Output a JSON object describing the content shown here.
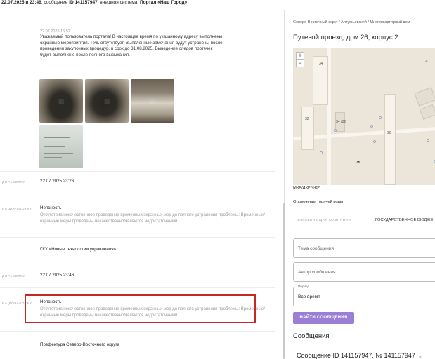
{
  "header": {
    "date": "22.07.2025 в 23:46",
    "rest": ", сообщение ",
    "msg_id": "ID 141157947",
    "system_prefix": ", внешняя система: ",
    "system": "Портал «Наш Город»"
  },
  "message": {
    "date": "22.07.2025 15:52",
    "text": "Уважаемый пользователь портала! В настоящее время по указанному адресу выполнены охранные мероприятия. Течь отсутствует. Выявленные замечания будут устранены после проведения закупочных процедур, в срок до 31.08.2025. Выведение следов протечек будет выполнено после полного высыхания."
  },
  "rows": {
    "r1_label": "ДОРАБОТКУ",
    "r1_value": "22.07.2025 23:26",
    "r2_label": "НА ДОРАБОТКУ",
    "r2_title": "Неясность",
    "r2_text": "Отсутствие/некачественное проведение временных/охранных мер до полного устранения проблемы: Временные/охранные меры проведены некачественно/являются недостаточными",
    "r3_value": "ГКУ «Новые технологии управления»",
    "r4_label": "ДОРАБОТКУ",
    "r4_value": "22.07.2025 23:46",
    "r5_label": "НА ДОРАБОТКУ",
    "r5_title": "Неясность",
    "r5_text": "Отсутствие/некачественное проведение временных/охранных мер до полного устранения проблемы: Временные/охранные меры проведены некачественно/являются недостаточными",
    "r6_value": "Префектура Северо-Восточного округа"
  },
  "right": {
    "breadcrumb": "Северо-Восточный округ / Алтуфьевский / Многоквартирный дом",
    "address": "Путевой проезд, дом 26, корпус 2",
    "map": {
      "zoom_in": "+",
      "zoom_out": "−",
      "b34": "34",
      "b32": "32",
      "b34k2": "34 (32",
      "b30": "30"
    },
    "mkr": "МКР/ДКР/ФКР",
    "outage": "Отключения горячей воды",
    "uk_label": "УПРАВЛЯЮЩАЯ КОМПАНИЯ",
    "uk_value": "ГОСУДАРСТВЕННОЕ БЮДЖЕ",
    "topic_placeholder": "Тема сообщения",
    "author_placeholder": "Автор сообщения",
    "period_legend": "Период",
    "period_value": "Все время",
    "search_button": "НАЙТИ СООБЩЕНИЯ",
    "messages_title": "Сообщения",
    "message_item": "Сообщение ID 141157947, № 141157947",
    "chevron": "⌄"
  }
}
